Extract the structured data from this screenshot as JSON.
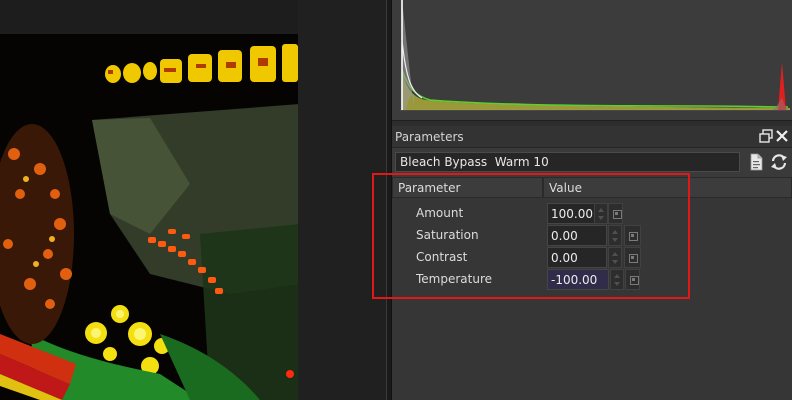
{
  "parameters_panel": {
    "title": "Parameters",
    "float_icon": "restore-window-icon",
    "close_icon": "close-icon",
    "preset": {
      "value": "Bleach Bypass  Warm 10",
      "doc_icon": "document-icon",
      "refresh_icon": "refresh-icon"
    },
    "table": {
      "columns": [
        "Parameter",
        "Value"
      ],
      "rows": [
        {
          "label": "Amount",
          "value": "100.00"
        },
        {
          "label": "Saturation",
          "value": "0.00"
        },
        {
          "label": "Contrast",
          "value": "0.00"
        },
        {
          "label": "Temperature",
          "value": "-100.00"
        }
      ]
    }
  },
  "histogram": {
    "colors": {
      "red": "#e02020",
      "green": "#60d030",
      "yellow": "#d8d820",
      "white": "#ffffff"
    }
  },
  "annotation": {
    "highlight_color": "#e01818"
  }
}
